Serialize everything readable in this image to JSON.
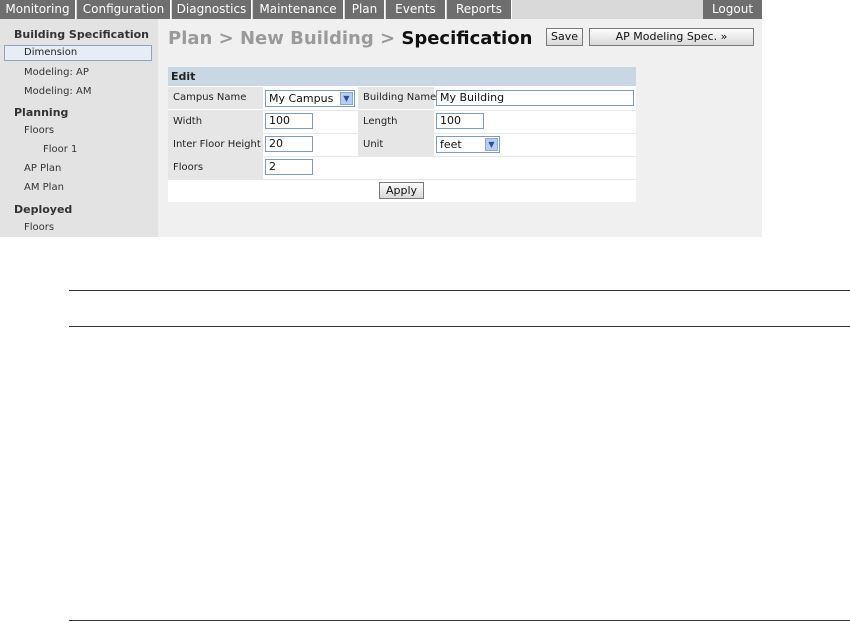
{
  "topnav": {
    "tabs": [
      "Monitoring",
      "Configuration",
      "Diagnostics",
      "Maintenance",
      "Plan",
      "Events",
      "Reports"
    ],
    "logout": "Logout"
  },
  "sidebar": {
    "building_spec": "Building Specification",
    "dimension": "Dimension",
    "modeling_ap": "Modeling: AP",
    "modeling_am": "Modeling: AM",
    "planning": "Planning",
    "floors": "Floors",
    "floor1": "Floor 1",
    "ap_plan": "AP Plan",
    "am_plan": "AM Plan",
    "deployed": "Deployed",
    "deployed_floors": "Floors"
  },
  "page": {
    "crumb1": "Plan",
    "sep1": " > ",
    "crumb2": "New Building",
    "sep2": " > ",
    "current": "Specification",
    "save": "Save",
    "ap_modeling_spec": "AP Modeling Spec. »"
  },
  "edit": {
    "title": "Edit",
    "campus_name_label": "Campus Name",
    "campus_name_value": "My Campus",
    "building_name_label": "Building Name",
    "building_name_value": "My Building",
    "width_label": "Width",
    "width_value": "100",
    "length_label": "Length",
    "length_value": "100",
    "inter_floor_label": "Inter Floor Height",
    "inter_floor_value": "20",
    "unit_label": "Unit",
    "unit_value": "feet",
    "floors_label": "Floors",
    "floors_value": "2",
    "apply": "Apply"
  },
  "icons": {
    "dropdown": "chevron-down-icon"
  }
}
